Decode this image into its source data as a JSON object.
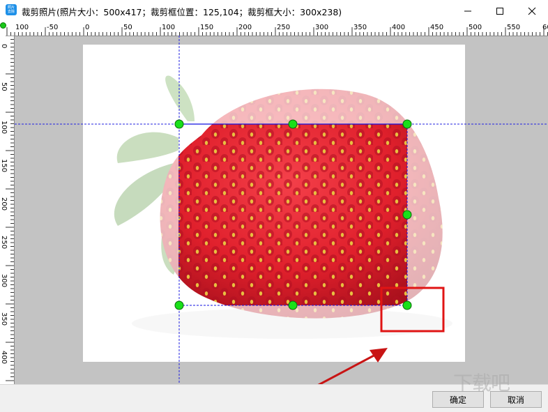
{
  "window": {
    "icon_text_1": "照片",
    "icon_text_2": "去除",
    "title": "裁剪照片(照片大小：500x417；裁剪框位置：125,104；裁剪框大小：300x238)",
    "minimize_icon": "minimize-icon",
    "maximize_icon": "maximize-icon",
    "close_icon": "close-icon"
  },
  "ruler_top": {
    "labels": [
      "100",
      "-50",
      "0",
      "50",
      "100",
      "150",
      "200",
      "250",
      "300",
      "350",
      "400",
      "450",
      "500",
      "550",
      "600"
    ]
  },
  "ruler_left": {
    "labels": [
      "0",
      "50",
      "100",
      "150",
      "200",
      "250",
      "300",
      "350",
      "400"
    ]
  },
  "photo": {
    "size": "500x417",
    "subject": "strawberry"
  },
  "crop": {
    "position": "125,104",
    "size": "300x238",
    "handle_color": "#19e019",
    "border_color": "#1010e0"
  },
  "annotation": {
    "box_color": "#e01414",
    "arrow_color": "#c81414"
  },
  "buttons": {
    "ok": "确定",
    "cancel": "取消"
  },
  "watermark": "下载吧"
}
